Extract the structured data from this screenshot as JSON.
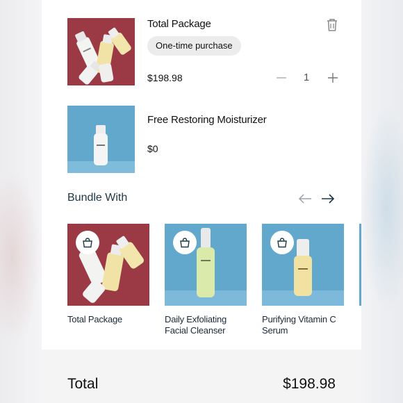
{
  "cart": {
    "items": [
      {
        "title": "Total Package",
        "purchase_type": "One-time purchase",
        "price": "$198.98",
        "quantity": "1",
        "image_icon": "product-bottles-image"
      },
      {
        "title": "Free Restoring Moisturizer",
        "price": "$0",
        "image_icon": "moisturizer-bottle-image"
      }
    ]
  },
  "bundle": {
    "title": "Bundle With",
    "cards": [
      {
        "name": "Total Package"
      },
      {
        "name": "Daily Exfoliating Facial Cleanser"
      },
      {
        "name": "Purifying Vitamin C Serum"
      }
    ]
  },
  "summary": {
    "label": "Total",
    "value": "$198.98"
  },
  "colors": {
    "accent": "#1c3645",
    "red_bg": "#9b3a45",
    "blue_bg": "#62a8cd",
    "pill_bg": "#ececec",
    "footer_bg": "#f4f4f4"
  }
}
